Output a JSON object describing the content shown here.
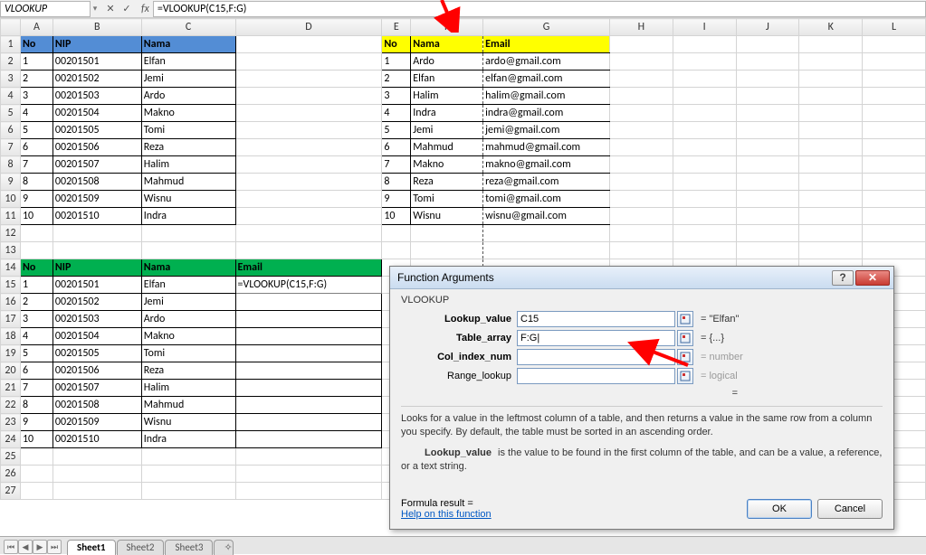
{
  "nameBox": "VLOOKUP",
  "formula": "=VLOOKUP(C15,F:G)",
  "fx": "fx",
  "columns": [
    "A",
    "B",
    "C",
    "D",
    "E",
    "F",
    "G",
    "H",
    "I",
    "J",
    "K",
    "L"
  ],
  "rowCount": 27,
  "table1": {
    "headers": [
      "No",
      "NIP",
      "Nama"
    ],
    "rows": [
      [
        "1",
        "00201501",
        "Elfan"
      ],
      [
        "2",
        "00201502",
        "Jemi"
      ],
      [
        "3",
        "00201503",
        "Ardo"
      ],
      [
        "4",
        "00201504",
        "Makno"
      ],
      [
        "5",
        "00201505",
        "Tomi"
      ],
      [
        "6",
        "00201506",
        "Reza"
      ],
      [
        "7",
        "00201507",
        "Halim"
      ],
      [
        "8",
        "00201508",
        "Mahmud"
      ],
      [
        "9",
        "00201509",
        "Wisnu"
      ],
      [
        "10",
        "00201510",
        "Indra"
      ]
    ]
  },
  "table2": {
    "headers": [
      "No",
      "Nama",
      "Email"
    ],
    "rows": [
      [
        "1",
        "Ardo",
        "ardo@gmail.com"
      ],
      [
        "2",
        "Elfan",
        "elfan@gmail.com"
      ],
      [
        "3",
        "Halim",
        "halim@gmail.com"
      ],
      [
        "4",
        "Indra",
        "indra@gmail.com"
      ],
      [
        "5",
        "Jemi",
        "jemi@gmail.com"
      ],
      [
        "6",
        "Mahmud",
        "mahmud@gmail.com"
      ],
      [
        "7",
        "Makno",
        "makno@gmail.com"
      ],
      [
        "8",
        "Reza",
        "reza@gmail.com"
      ],
      [
        "9",
        "Tomi",
        "tomi@gmail.com"
      ],
      [
        "10",
        "Wisnu",
        "wisnu@gmail.com"
      ]
    ]
  },
  "table3": {
    "headers": [
      "No",
      "NIP",
      "Nama",
      "Email"
    ],
    "formulaCell": "=VLOOKUP(C15,F:G)",
    "rows": [
      [
        "1",
        "00201501",
        "Elfan"
      ],
      [
        "2",
        "00201502",
        "Jemi"
      ],
      [
        "3",
        "00201503",
        "Ardo"
      ],
      [
        "4",
        "00201504",
        "Makno"
      ],
      [
        "5",
        "00201505",
        "Tomi"
      ],
      [
        "6",
        "00201506",
        "Reza"
      ],
      [
        "7",
        "00201507",
        "Halim"
      ],
      [
        "8",
        "00201508",
        "Mahmud"
      ],
      [
        "9",
        "00201509",
        "Wisnu"
      ],
      [
        "10",
        "00201510",
        "Indra"
      ]
    ]
  },
  "dialog": {
    "title": "Function Arguments",
    "fn": "VLOOKUP",
    "args": [
      {
        "label": "Lookup_value",
        "value": "C15",
        "result": "\"Elfan\"",
        "bold": true
      },
      {
        "label": "Table_array",
        "value": "F:G",
        "result": "{...}",
        "bold": true,
        "cursor": true
      },
      {
        "label": "Col_index_num",
        "value": "",
        "result": "number",
        "bold": true,
        "grey": true
      },
      {
        "label": "Range_lookup",
        "value": "",
        "result": "logical",
        "bold": false,
        "grey": true
      }
    ],
    "eq": "=",
    "desc1": "Looks for a value in the leftmost column of a table, and then returns a value in the same row from a column you specify. By default, the table must be sorted in an ascending order.",
    "desc2label": "Lookup_value",
    "desc2": " is the value to be found in the first column of the table, and can be a value, a reference, or a text string.",
    "formulaResultLabel": "Formula result =",
    "formulaResult": "",
    "help": "Help on this function",
    "ok": "OK",
    "cancel": "Cancel"
  },
  "tabs": [
    "Sheet1",
    "Sheet2",
    "Sheet3"
  ]
}
